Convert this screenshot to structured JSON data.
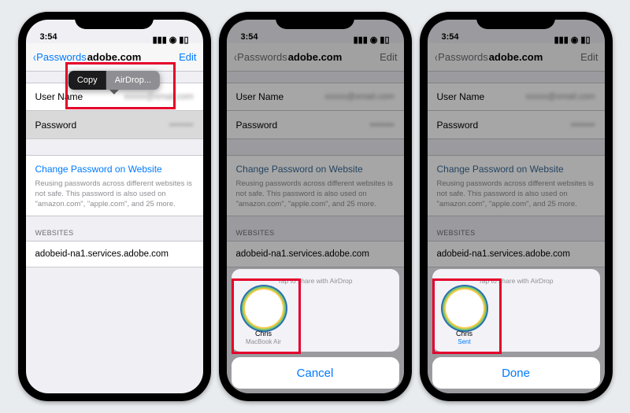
{
  "status": {
    "time": "3:54",
    "net": "◢",
    "wifi": "⦿",
    "batt": "▮▮"
  },
  "nav": {
    "back": "Passwords",
    "title": "adobe.com",
    "edit": "Edit"
  },
  "rows": {
    "user": "User Name",
    "userVal": "xxxxx@xmail.com",
    "pass": "Password",
    "passVal": "••••••••"
  },
  "link": {
    "label": "Change Password on Website",
    "note": "Reusing passwords across different websites is not safe. This password is also used on \"amazon.com\", \"apple.com\", and 25 more."
  },
  "sites": {
    "header": "WEBSITES",
    "item": "adobeid-na1.services.adobe.com"
  },
  "popup": {
    "copy": "Copy",
    "airdrop": "AirDrop..."
  },
  "shareHint": "Tap to share with AirDrop",
  "contact": {
    "name": "Chris",
    "device": "MacBook Air",
    "sent": "Sent"
  },
  "buttons": {
    "cancel": "Cancel",
    "done": "Done"
  }
}
